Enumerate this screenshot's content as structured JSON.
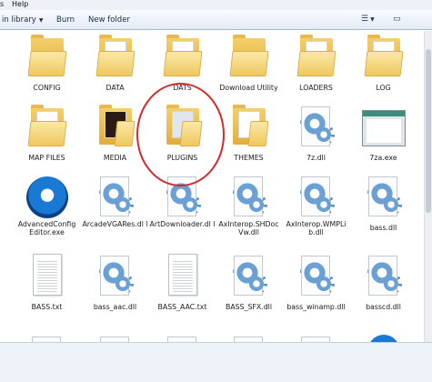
{
  "menu": {
    "help": "Help"
  },
  "toolbar": {
    "include": "in library",
    "burn": "Burn",
    "new_folder": "New folder",
    "view_icon": "views-icon",
    "pane_icon": "preview-pane-icon"
  },
  "items": [
    {
      "label": "CONFIG",
      "kind": "folder"
    },
    {
      "label": "DATA",
      "kind": "folder"
    },
    {
      "label": "DATS",
      "kind": "folder"
    },
    {
      "label": "Download Utility",
      "kind": "folder"
    },
    {
      "label": "LOADERS",
      "kind": "folder"
    },
    {
      "label": "LOG",
      "kind": "folder"
    },
    {
      "label": "MAP FILES",
      "kind": "folder"
    },
    {
      "label": "MEDIA",
      "kind": "folder"
    },
    {
      "label": "PLUGINS",
      "kind": "folder"
    },
    {
      "label": "THEMES",
      "kind": "folder"
    },
    {
      "label": "7z.dll",
      "kind": "dll"
    },
    {
      "label": "7za.exe",
      "kind": "exe-window"
    },
    {
      "label": "AdvancedConfig Editor.exe",
      "kind": "app"
    },
    {
      "label": "ArcadeVGARes.dl l",
      "kind": "dll"
    },
    {
      "label": "ArtDownloader.dl l",
      "kind": "dll"
    },
    {
      "label": "AxInterop.SHDoc Vw.dll",
      "kind": "dll"
    },
    {
      "label": "AxInterop.WMPLi b.dll",
      "kind": "dll"
    },
    {
      "label": "bass.dll",
      "kind": "dll"
    },
    {
      "label": "BASS.txt",
      "kind": "txt"
    },
    {
      "label": "bass_aac.dll",
      "kind": "dll"
    },
    {
      "label": "BASS_AAC.txt",
      "kind": "txt"
    },
    {
      "label": "BASS_SFX.dll",
      "kind": "dll"
    },
    {
      "label": "bass_winamp.dll",
      "kind": "dll"
    },
    {
      "label": "basscd.dll",
      "kind": "dll"
    }
  ],
  "annotation": {
    "color": "#d42a2a",
    "target": "PLUGINS"
  },
  "colors": {
    "folder": "#efc85f",
    "selection_border": "#a8b9cf"
  }
}
